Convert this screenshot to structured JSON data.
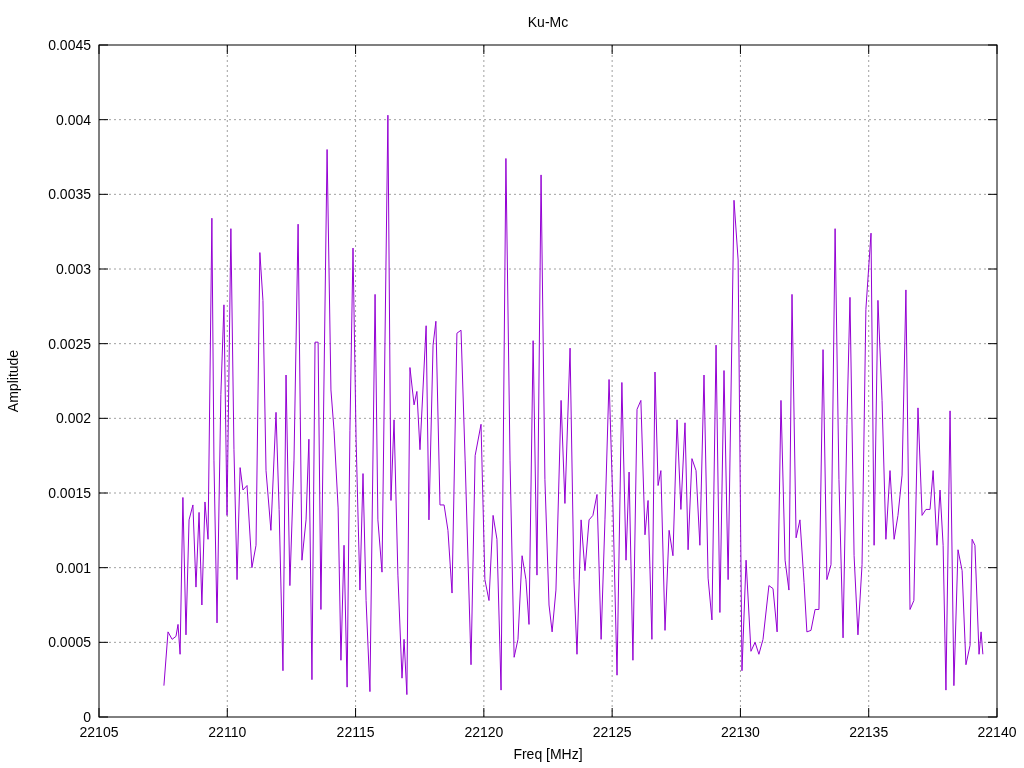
{
  "chart_data": {
    "type": "line",
    "title": "Ku-Mc",
    "xlabel": "Freq [MHz]",
    "ylabel": "Amplitude",
    "grid": true,
    "xlim": [
      22105,
      22140
    ],
    "ylim": [
      0,
      0.0045
    ],
    "xticks": [
      22105,
      22110,
      22115,
      22120,
      22125,
      22130,
      22135,
      22140
    ],
    "yticks": [
      0,
      0.0005,
      0.001,
      0.0015,
      0.002,
      0.0025,
      0.003,
      0.0035,
      0.004,
      0.0045
    ],
    "x": [
      22107.53,
      22107.69,
      22107.85,
      22108.0,
      22108.08,
      22108.16,
      22108.27,
      22108.39,
      22108.51,
      22108.66,
      22108.78,
      22108.9,
      22109.01,
      22109.13,
      22109.25,
      22109.4,
      22109.48,
      22109.6,
      22109.75,
      22109.87,
      22109.99,
      22110.14,
      22110.26,
      22110.38,
      22110.5,
      22110.61,
      22110.77,
      22110.96,
      22111.12,
      22111.27,
      22111.39,
      22111.51,
      22111.7,
      22111.9,
      22112.02,
      22112.17,
      22112.29,
      22112.44,
      22112.6,
      22112.76,
      22112.91,
      22113.07,
      22113.18,
      22113.3,
      22113.42,
      22113.54,
      22113.65,
      22113.89,
      22114.04,
      22114.16,
      22114.32,
      22114.43,
      22114.55,
      22114.67,
      22114.78,
      22114.9,
      22115.02,
      22115.17,
      22115.29,
      22115.41,
      22115.56,
      22115.76,
      22115.87,
      22116.03,
      22116.26,
      22116.38,
      22116.5,
      22116.65,
      22116.81,
      22116.89,
      22117.0,
      22117.12,
      22117.28,
      22117.39,
      22117.51,
      22117.75,
      22117.86,
      22118.02,
      22118.13,
      22118.29,
      22118.45,
      22118.6,
      22118.76,
      22118.95,
      22119.11,
      22119.27,
      22119.5,
      22119.66,
      22119.89,
      22120.04,
      22120.2,
      22120.36,
      22120.51,
      22120.67,
      22120.86,
      22121.02,
      22121.18,
      22121.33,
      22121.49,
      22121.64,
      22121.76,
      22121.92,
      22122.07,
      22122.23,
      22122.38,
      22122.54,
      22122.66,
      22122.81,
      22123.01,
      22123.16,
      22123.36,
      22123.51,
      22123.63,
      22123.79,
      22123.94,
      22124.1,
      22124.25,
      22124.41,
      22124.57,
      22124.72,
      22124.88,
      22125.03,
      22125.19,
      22125.38,
      22125.54,
      22125.66,
      22125.81,
      22125.97,
      22126.12,
      22126.28,
      22126.4,
      22126.55,
      22126.67,
      22126.79,
      22126.9,
      22127.06,
      22127.22,
      22127.37,
      22127.53,
      22127.68,
      22127.84,
      22127.96,
      22128.11,
      22128.27,
      22128.42,
      22128.58,
      22128.74,
      22128.89,
      22129.05,
      22129.2,
      22129.36,
      22129.52,
      22129.75,
      22129.91,
      22130.06,
      22130.22,
      22130.41,
      22130.57,
      22130.72,
      22130.88,
      22131.11,
      22131.27,
      22131.43,
      22131.58,
      22131.74,
      22131.89,
      22132.01,
      22132.17,
      22132.32,
      22132.48,
      22132.59,
      22132.75,
      22132.91,
      22133.06,
      22133.22,
      22133.37,
      22133.53,
      22133.69,
      22133.84,
      22134.0,
      22134.15,
      22134.27,
      22134.43,
      22134.58,
      22134.74,
      22134.89,
      22135.09,
      22135.21,
      22135.36,
      22135.52,
      22135.67,
      22135.83,
      22135.99,
      22136.14,
      22136.3,
      22136.45,
      22136.61,
      22136.76,
      22136.92,
      22137.08,
      22137.23,
      22137.39,
      22137.51,
      22137.66,
      22137.78,
      22137.9,
      22138.01,
      22138.17,
      22138.32,
      22138.48,
      22138.64,
      22138.79,
      22138.95,
      22139.03,
      22139.14,
      22139.3,
      22139.38,
      22139.45
    ],
    "series": [
      {
        "color": "#9400d3",
        "values": [
          0.00021,
          0.00057,
          0.00052,
          0.00054,
          0.00062,
          0.00042,
          0.00147,
          0.00055,
          0.00132,
          0.00142,
          0.00087,
          0.00137,
          0.00075,
          0.00144,
          0.00119,
          0.00334,
          0.00172,
          0.00063,
          0.00216,
          0.00276,
          0.00135,
          0.00327,
          0.00179,
          0.00092,
          0.00167,
          0.00152,
          0.00155,
          0.001,
          0.00115,
          0.00311,
          0.00279,
          0.00165,
          0.00125,
          0.00204,
          0.00139,
          0.00031,
          0.00229,
          0.00088,
          0.00172,
          0.0033,
          0.00105,
          0.00132,
          0.00186,
          0.00025,
          0.00251,
          0.00251,
          0.00072,
          0.0038,
          0.00219,
          0.00192,
          0.0014,
          0.00038,
          0.00115,
          0.0002,
          0.00192,
          0.00314,
          0.00186,
          0.00085,
          0.00163,
          0.00078,
          0.00017,
          0.00283,
          0.00132,
          0.00097,
          0.00403,
          0.00145,
          0.00199,
          0.00095,
          0.00026,
          0.00052,
          0.00015,
          0.00234,
          0.00209,
          0.00218,
          0.00179,
          0.00262,
          0.00132,
          0.00249,
          0.00265,
          0.00142,
          0.00142,
          0.00125,
          0.00083,
          0.00257,
          0.00259,
          0.00172,
          0.00035,
          0.00175,
          0.00196,
          0.00092,
          0.00078,
          0.00135,
          0.00119,
          0.00018,
          0.00374,
          0.00172,
          0.0004,
          0.00052,
          0.00108,
          0.00092,
          0.00062,
          0.00252,
          0.00095,
          0.00363,
          0.00159,
          0.00075,
          0.00057,
          0.00085,
          0.00212,
          0.00143,
          0.00247,
          0.00092,
          0.00042,
          0.00132,
          0.00098,
          0.00132,
          0.00135,
          0.00149,
          0.00052,
          0.00132,
          0.00226,
          0.00142,
          0.00028,
          0.00224,
          0.00105,
          0.00164,
          0.00038,
          0.00206,
          0.00212,
          0.00122,
          0.00145,
          0.00052,
          0.00231,
          0.00155,
          0.00165,
          0.00058,
          0.00125,
          0.00108,
          0.00199,
          0.00139,
          0.00197,
          0.00112,
          0.00173,
          0.00165,
          0.00115,
          0.00229,
          0.00093,
          0.00065,
          0.00249,
          0.0007,
          0.00232,
          0.00092,
          0.00346,
          0.00306,
          0.00031,
          0.00105,
          0.00044,
          0.0005,
          0.00042,
          0.00052,
          0.00088,
          0.00086,
          0.00057,
          0.00212,
          0.00105,
          0.00085,
          0.00283,
          0.0012,
          0.00132,
          0.0009,
          0.00057,
          0.00058,
          0.00072,
          0.00072,
          0.00246,
          0.00092,
          0.00102,
          0.00327,
          0.00159,
          0.00053,
          0.00196,
          0.00281,
          0.00108,
          0.00055,
          0.00102,
          0.00273,
          0.00324,
          0.00115,
          0.00279,
          0.00212,
          0.00119,
          0.00165,
          0.00119,
          0.00135,
          0.00162,
          0.00286,
          0.00072,
          0.00078,
          0.00207,
          0.00135,
          0.00139,
          0.00139,
          0.00165,
          0.00115,
          0.00152,
          0.00115,
          0.00018,
          0.00205,
          0.00021,
          0.00112,
          0.00098,
          0.00035,
          0.00048,
          0.00119,
          0.00115,
          0.00042,
          0.00057,
          0.00042
        ]
      }
    ]
  }
}
